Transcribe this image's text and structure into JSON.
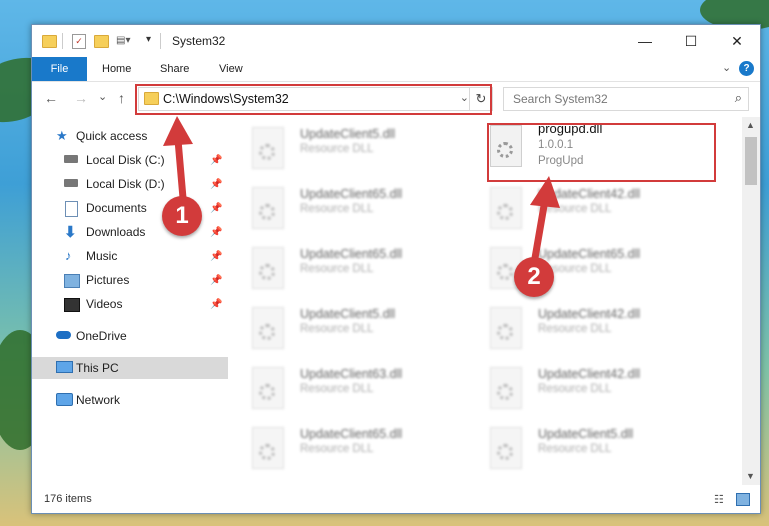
{
  "window": {
    "title": "System32",
    "controls": {
      "minimize": "—",
      "maximize": "☐",
      "close": "✕"
    }
  },
  "ribbon": {
    "tabs": [
      "File",
      "Home",
      "Share",
      "View"
    ],
    "expand": "⌄",
    "help": "?"
  },
  "nav": {
    "back": "←",
    "forward": "→",
    "recent": "⌄",
    "up": "↑",
    "address": "C:\\Windows\\System32",
    "refresh": "↻",
    "search_placeholder": "Search System32",
    "search_icon": "⌕"
  },
  "sidebar": {
    "items": [
      {
        "label": "Quick access",
        "icon": "star-icon"
      },
      {
        "label": "Local Disk (C:)",
        "icon": "drive-icon",
        "pinned": true
      },
      {
        "label": "Local Disk (D:)",
        "icon": "drive-icon",
        "pinned": true
      },
      {
        "label": "Documents",
        "icon": "documents-icon",
        "pinned": true
      },
      {
        "label": "Downloads",
        "icon": "downloads-icon",
        "pinned": true
      },
      {
        "label": "Music",
        "icon": "music-icon",
        "pinned": true
      },
      {
        "label": "Pictures",
        "icon": "pictures-icon",
        "pinned": true
      },
      {
        "label": "Videos",
        "icon": "videos-icon",
        "pinned": true
      },
      {
        "label": "OneDrive",
        "icon": "onedrive-icon"
      },
      {
        "label": "This PC",
        "icon": "this-pc-icon",
        "selected": true
      },
      {
        "label": "Network",
        "icon": "network-icon"
      }
    ],
    "pin_glyph": "📌"
  },
  "files": {
    "highlighted": {
      "name": "progupd.dll",
      "version": "1.0.0.1",
      "product": "ProgUpd"
    },
    "column_left": [
      {
        "name": "UpdateClient5.dll",
        "desc": "Resource DLL"
      },
      {
        "name": "UpdateClient65.dll",
        "desc": "Resource DLL"
      },
      {
        "name": "UpdateClient65.dll",
        "desc": "Resource DLL"
      },
      {
        "name": "UpdateClient5.dll",
        "desc": "Resource DLL"
      },
      {
        "name": "UpdateClient63.dll",
        "desc": "Resource DLL"
      },
      {
        "name": "UpdateClient65.dll",
        "desc": "Resource DLL"
      }
    ],
    "column_right": [
      {
        "name": "UpdateClient42.dll",
        "desc": "Resource DLL"
      },
      {
        "name": "UpdateClient65.dll",
        "desc": "Resource DLL"
      },
      {
        "name": "UpdateClient42.dll",
        "desc": "Resource DLL"
      },
      {
        "name": "UpdateClient42.dll",
        "desc": "Resource DLL"
      },
      {
        "name": "UpdateClient5.dll",
        "desc": "Resource DLL"
      }
    ]
  },
  "status": {
    "count": "176 items"
  },
  "annotations": {
    "step1": "1",
    "step2": "2",
    "color": "#d23b3b"
  }
}
